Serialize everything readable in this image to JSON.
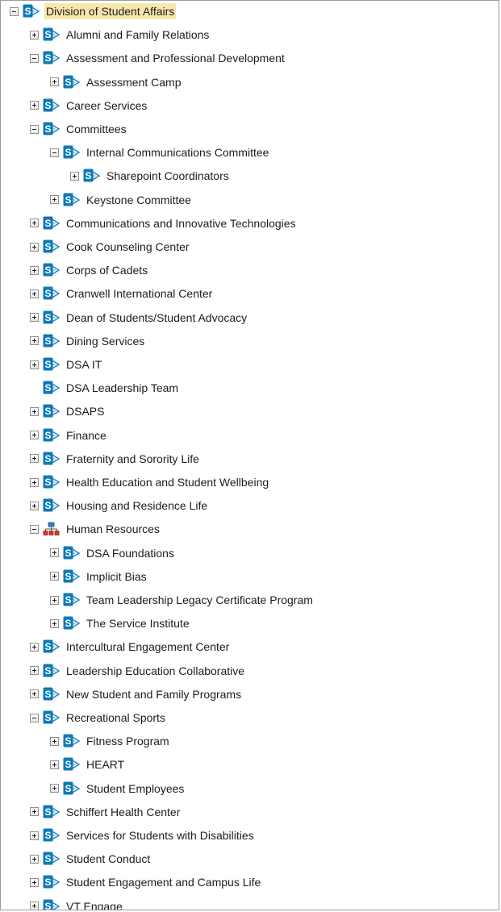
{
  "tree": {
    "nodes": [
      {
        "label": "Division of Student Affairs",
        "level": 0,
        "toggle": "minus",
        "icon": "sharepoint-site-icon",
        "selected": true
      },
      {
        "label": "Alumni and Family Relations",
        "level": 1,
        "toggle": "plus",
        "icon": "sharepoint-site-icon"
      },
      {
        "label": "Assessment and Professional Development",
        "level": 1,
        "toggle": "minus",
        "icon": "sharepoint-site-icon"
      },
      {
        "label": "Assessment Camp",
        "level": 2,
        "toggle": "plus",
        "icon": "sharepoint-site-icon"
      },
      {
        "label": "Career Services",
        "level": 1,
        "toggle": "plus",
        "icon": "sharepoint-site-icon"
      },
      {
        "label": "Committees",
        "level": 1,
        "toggle": "minus",
        "icon": "sharepoint-site-icon"
      },
      {
        "label": "Internal Communications Committee",
        "level": 2,
        "toggle": "minus",
        "icon": "sharepoint-site-icon"
      },
      {
        "label": "Sharepoint Coordinators",
        "level": 3,
        "toggle": "plus",
        "icon": "sharepoint-site-icon"
      },
      {
        "label": "Keystone Committee",
        "level": 2,
        "toggle": "plus",
        "icon": "sharepoint-site-icon"
      },
      {
        "label": "Communications and Innovative Technologies",
        "level": 1,
        "toggle": "plus",
        "icon": "sharepoint-site-icon"
      },
      {
        "label": "Cook Counseling Center",
        "level": 1,
        "toggle": "plus",
        "icon": "sharepoint-site-icon"
      },
      {
        "label": "Corps of Cadets",
        "level": 1,
        "toggle": "plus",
        "icon": "sharepoint-site-icon"
      },
      {
        "label": "Cranwell International Center",
        "level": 1,
        "toggle": "plus",
        "icon": "sharepoint-site-icon"
      },
      {
        "label": "Dean of Students/Student Advocacy",
        "level": 1,
        "toggle": "plus",
        "icon": "sharepoint-site-icon"
      },
      {
        "label": "Dining Services",
        "level": 1,
        "toggle": "plus",
        "icon": "sharepoint-site-icon"
      },
      {
        "label": "DSA IT",
        "level": 1,
        "toggle": "plus",
        "icon": "sharepoint-site-icon"
      },
      {
        "label": "DSA Leadership Team",
        "level": 1,
        "toggle": "none",
        "icon": "sharepoint-site-icon"
      },
      {
        "label": "DSAPS",
        "level": 1,
        "toggle": "plus",
        "icon": "sharepoint-site-icon"
      },
      {
        "label": "Finance",
        "level": 1,
        "toggle": "plus",
        "icon": "sharepoint-site-icon"
      },
      {
        "label": "Fraternity and Sorority Life",
        "level": 1,
        "toggle": "plus",
        "icon": "sharepoint-site-icon"
      },
      {
        "label": "Health Education and Student Wellbeing",
        "level": 1,
        "toggle": "plus",
        "icon": "sharepoint-site-icon"
      },
      {
        "label": "Housing and Residence Life",
        "level": 1,
        "toggle": "plus",
        "icon": "sharepoint-site-icon"
      },
      {
        "label": "Human Resources",
        "level": 1,
        "toggle": "minus",
        "icon": "site-hierarchy-icon"
      },
      {
        "label": "DSA Foundations",
        "level": 2,
        "toggle": "plus",
        "icon": "sharepoint-site-icon"
      },
      {
        "label": "Implicit Bias",
        "level": 2,
        "toggle": "plus",
        "icon": "sharepoint-site-icon"
      },
      {
        "label": "Team Leadership Legacy Certificate Program",
        "level": 2,
        "toggle": "plus",
        "icon": "sharepoint-site-icon"
      },
      {
        "label": "The Service Institute",
        "level": 2,
        "toggle": "plus",
        "icon": "sharepoint-site-icon"
      },
      {
        "label": "Intercultural Engagement Center",
        "level": 1,
        "toggle": "plus",
        "icon": "sharepoint-site-icon"
      },
      {
        "label": "Leadership Education Collaborative",
        "level": 1,
        "toggle": "plus",
        "icon": "sharepoint-site-icon"
      },
      {
        "label": "New Student and Family Programs",
        "level": 1,
        "toggle": "plus",
        "icon": "sharepoint-site-icon"
      },
      {
        "label": "Recreational Sports",
        "level": 1,
        "toggle": "minus",
        "icon": "sharepoint-site-icon"
      },
      {
        "label": "Fitness Program",
        "level": 2,
        "toggle": "plus",
        "icon": "sharepoint-site-icon"
      },
      {
        "label": "HEART",
        "level": 2,
        "toggle": "plus",
        "icon": "sharepoint-site-icon"
      },
      {
        "label": "Student Employees",
        "level": 2,
        "toggle": "plus",
        "icon": "sharepoint-site-icon"
      },
      {
        "label": "Schiffert Health Center",
        "level": 1,
        "toggle": "plus",
        "icon": "sharepoint-site-icon"
      },
      {
        "label": "Services for Students with Disabilities",
        "level": 1,
        "toggle": "plus",
        "icon": "sharepoint-site-icon"
      },
      {
        "label": "Student Conduct",
        "level": 1,
        "toggle": "plus",
        "icon": "sharepoint-site-icon"
      },
      {
        "label": "Student Engagement and Campus Life",
        "level": 1,
        "toggle": "plus",
        "icon": "sharepoint-site-icon"
      },
      {
        "label": "VT Engage",
        "level": 1,
        "toggle": "plus",
        "icon": "sharepoint-site-icon"
      }
    ]
  },
  "colors": {
    "selected_bg": "#f6e7ad",
    "sharepoint_blue": "#0f79b7",
    "border": "#9a9a9a"
  }
}
